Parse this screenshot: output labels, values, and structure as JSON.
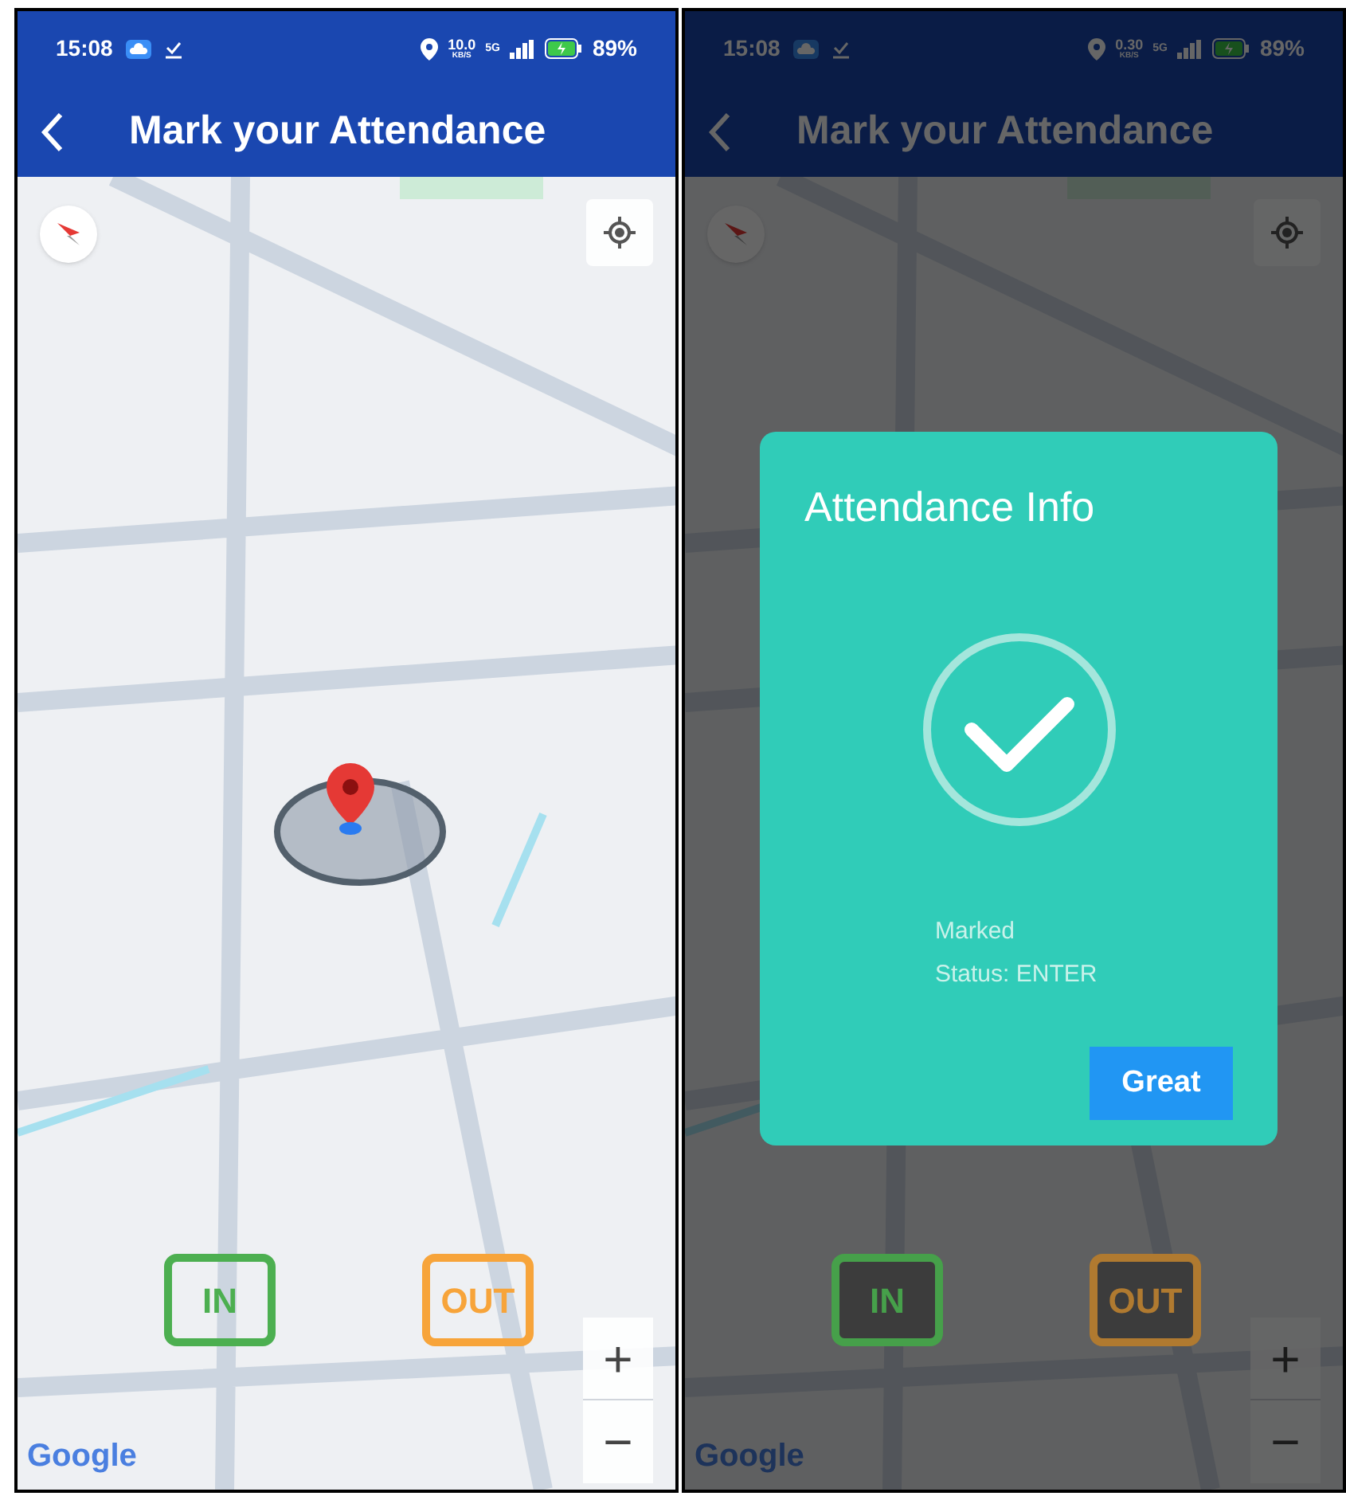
{
  "phones": [
    {
      "dimmed": false,
      "status_bar": {
        "time": "15:08",
        "speed": "10.0",
        "speed_unit": "KB/S",
        "network": "5G",
        "battery": "89%"
      },
      "header": {
        "title": "Mark your Attendance"
      },
      "map": {
        "attribution": "Google",
        "zoom_in": "+",
        "zoom_out": "−"
      },
      "actions": [
        {
          "label": "IN",
          "color": "#4caf50"
        },
        {
          "label": "OUT",
          "color": "#f7a43a"
        }
      ]
    },
    {
      "dimmed": true,
      "status_bar": {
        "time": "15:08",
        "speed": "0.30",
        "speed_unit": "KB/S",
        "network": "5G",
        "battery": "89%"
      },
      "header": {
        "title": "Mark your Attendance"
      },
      "map": {
        "attribution": "Google",
        "zoom_in": "+",
        "zoom_out": "−"
      },
      "actions": [
        {
          "label": "IN",
          "color": "#46a04a"
        },
        {
          "label": "OUT",
          "color": "#b07a30"
        }
      ],
      "dialog": {
        "title": "Attendance Info",
        "message": "Marked",
        "status": "Status: ENTER",
        "button": "Great"
      }
    }
  ]
}
